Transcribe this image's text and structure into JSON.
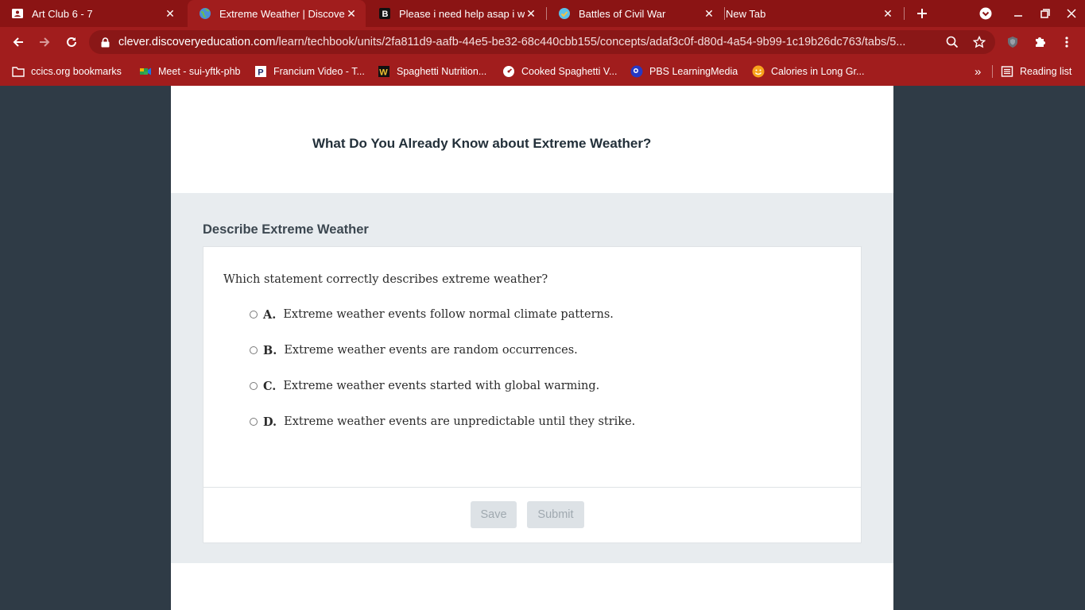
{
  "browser": {
    "tabs": [
      {
        "title": "Art Club 6 - 7",
        "icon": "classroom-icon",
        "active": false
      },
      {
        "title": "Extreme Weather | Discovery",
        "icon": "globe-icon",
        "active": true
      },
      {
        "title": "Please i need help asap i will",
        "icon": "brainly-icon",
        "active": false
      },
      {
        "title": "Battles of Civil War",
        "icon": "check-badge-icon",
        "active": false
      },
      {
        "title": "New Tab",
        "icon": "",
        "active": false
      }
    ],
    "url_host": "clever.discoveryeducation.com",
    "url_path": "/learn/techbook/units/2fa811d9-aafb-44e5-be32-68c440cbb155/concepts/adaf3c0f-d80d-4a54-9b99-1c19b26dc763/tabs/5..."
  },
  "bookmarks": {
    "items": [
      {
        "label": "ccics.org bookmarks",
        "icon": "folder-icon"
      },
      {
        "label": "Meet - sui-yftk-phb",
        "icon": "meet-icon"
      },
      {
        "label": "Francium Video - T...",
        "icon": "p-logo-icon"
      },
      {
        "label": "Spaghetti Nutrition...",
        "icon": "w-logo-icon"
      },
      {
        "label": "Cooked Spaghetti V...",
        "icon": "speedometer-icon"
      },
      {
        "label": "PBS LearningMedia",
        "icon": "pbs-icon"
      },
      {
        "label": "Calories in Long Gr...",
        "icon": "smiley-icon"
      }
    ],
    "more": "»",
    "reading_list": "Reading list"
  },
  "page": {
    "heading": "What Do You Already Know about Extreme Weather?",
    "section_title": "Describe Extreme Weather",
    "question": "Which statement correctly describes extreme weather?",
    "choices": [
      {
        "letter": "A.",
        "text": "Extreme weather events follow normal climate patterns."
      },
      {
        "letter": "B.",
        "text": "Extreme weather events are random occurrences."
      },
      {
        "letter": "C.",
        "text": "Extreme weather events started with global warming."
      },
      {
        "letter": "D.",
        "text": "Extreme weather events are unpredictable until they strike."
      }
    ],
    "save_label": "Save",
    "submit_label": "Submit"
  },
  "colors": {
    "chrome_dark": "#8b1414",
    "chrome": "#a11d1d",
    "page_bg": "#2f3b46",
    "disabled_button": "#dde2e6"
  }
}
